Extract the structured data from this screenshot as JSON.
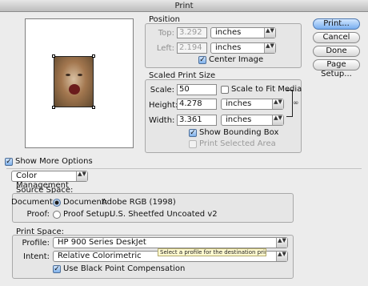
{
  "window": {
    "title": "Print"
  },
  "position": {
    "legend": "Position",
    "top_label": "Top:",
    "top_value": "3.292",
    "top_unit": "inches",
    "left_label": "Left:",
    "left_value": "2.194",
    "left_unit": "inches",
    "center_image_label": "Center Image",
    "center_image_checked": true
  },
  "scaled": {
    "legend": "Scaled Print Size",
    "scale_label": "Scale:",
    "scale_value": "50",
    "scale_to_fit_label": "Scale to Fit Media",
    "height_label": "Height:",
    "height_value": "4.278",
    "height_unit": "inches",
    "width_label": "Width:",
    "width_value": "3.361",
    "width_unit": "inches",
    "show_bounding_box_label": "Show Bounding Box",
    "print_selected_area_label": "Print Selected Area"
  },
  "buttons": {
    "print": "Print...",
    "cancel": "Cancel",
    "done": "Done",
    "page_setup": "Page Setup..."
  },
  "more_options": {
    "label": "Show More Options"
  },
  "color_management": {
    "selected": "Color Management"
  },
  "source_space": {
    "legend": "Source Space:",
    "document_label": "Document:",
    "document_option": "Document:",
    "document_value": "Adobe RGB (1998)",
    "proof_label": "Proof:",
    "proof_option": "Proof Setup:",
    "proof_value": "U.S. Sheetfed Uncoated v2"
  },
  "print_space": {
    "legend": "Print Space:",
    "profile_label": "Profile:",
    "profile_value": "HP 900 Series DeskJet",
    "intent_label": "Intent:",
    "intent_value": "Relative Colorimetric",
    "bpc_label": "Use Black Point Compensation",
    "tooltip": "Select a profile for the destination printer"
  },
  "icons": {
    "checkmark": "✓",
    "popup_arrows": "▲▼",
    "chain_link": "∞"
  }
}
